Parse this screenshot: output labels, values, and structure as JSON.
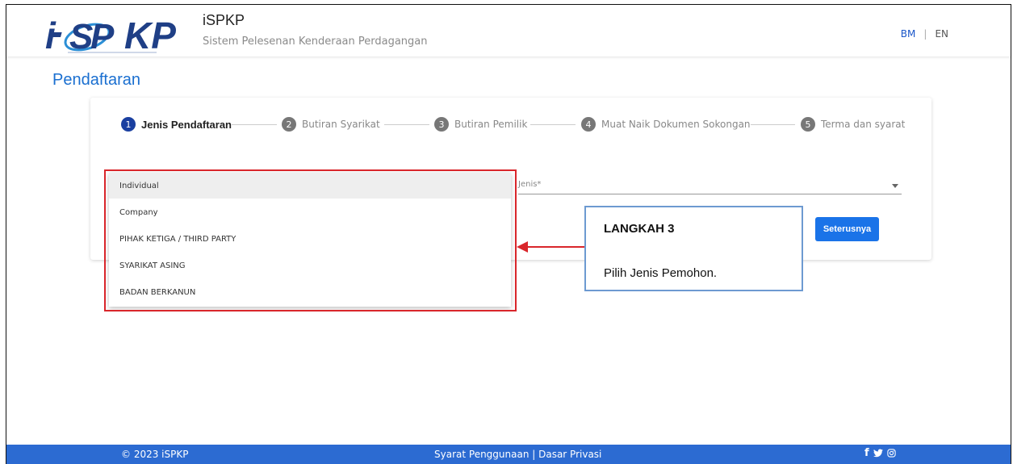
{
  "header": {
    "title": "iSPKP",
    "subtitle": "Sistem Pelesenan Kenderaan Perdagangan",
    "lang_bm": "BM",
    "lang_sep": "|",
    "lang_en": "EN"
  },
  "page_title": "Pendaftaran",
  "steps": [
    {
      "num": "1",
      "label": "Jenis Pendaftaran"
    },
    {
      "num": "2",
      "label": "Butiran Syarikat"
    },
    {
      "num": "3",
      "label": "Butiran Pemilik"
    },
    {
      "num": "4",
      "label": "Muat Naik Dokumen Sokongan"
    },
    {
      "num": "5",
      "label": "Terma dan syarat"
    }
  ],
  "form": {
    "jenis_label": "Jenis*",
    "next_label": "Seterusnya"
  },
  "dropdown": {
    "options": [
      "Individual",
      "Company",
      "PIHAK KETIGA / THIRD PARTY",
      "SYARIKAT ASING",
      "BADAN BERKANUN"
    ]
  },
  "callout": {
    "title": "LANGKAH 3",
    "body": "Pilih Jenis Pemohon."
  },
  "footer": {
    "copyright": "© 2023 iSPKP",
    "links": "Syarat Penggunaan | Dasar Privasi",
    "social_icons": [
      "facebook-icon",
      "twitter-icon",
      "instagram-icon"
    ]
  },
  "colors": {
    "brand_blue": "#1a73e8",
    "footer_blue": "#2c6bd2",
    "annotation_red": "#d9262b",
    "callout_border": "#6d9ad1"
  }
}
